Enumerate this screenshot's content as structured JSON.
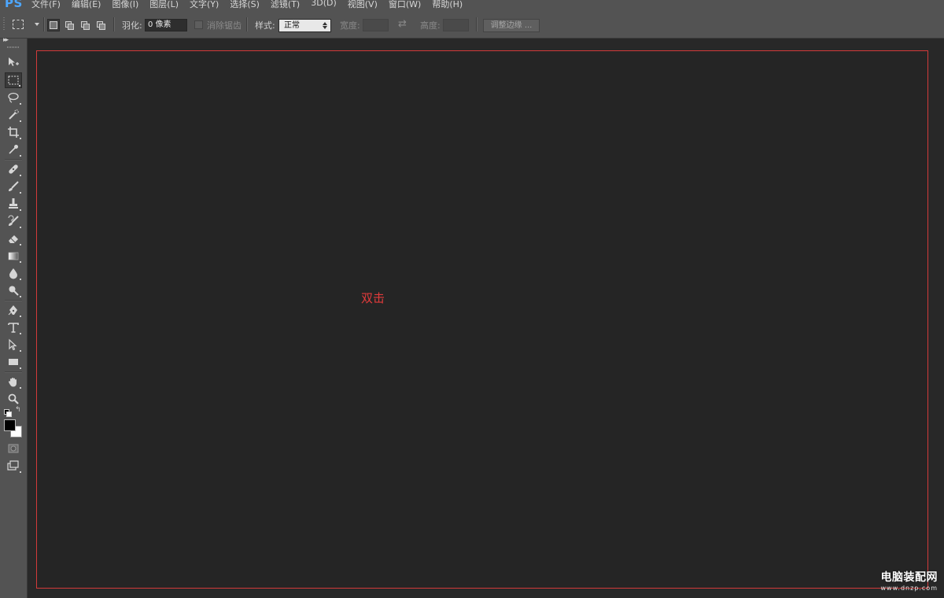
{
  "app": {
    "logo": "PS"
  },
  "menu": [
    "文件(F)",
    "编辑(E)",
    "图像(I)",
    "图层(L)",
    "文字(Y)",
    "选择(S)",
    "滤镜(T)",
    "3D(D)",
    "视图(V)",
    "窗口(W)",
    "帮助(H)"
  ],
  "options": {
    "feather_label": "羽化:",
    "feather_value": "0 像素",
    "antialias_label": "消除锯齿",
    "antialias_checked": false,
    "style_label": "样式:",
    "style_value": "正常",
    "width_label": "宽度:",
    "height_label": "高度:",
    "refine_edge_label": "调整边缘 ..."
  },
  "tools": {
    "active": "rectangular-marquee",
    "list": [
      "move",
      "rectangular-marquee",
      "lasso",
      "quick-selection",
      "crop",
      "eyedropper",
      "spot-healing-brush",
      "brush",
      "clone-stamp",
      "history-brush",
      "eraser",
      "gradient",
      "blur",
      "dodge",
      "pen",
      "type",
      "path-selection",
      "rectangle",
      "hand",
      "zoom",
      "quick-mask",
      "screen-mode"
    ],
    "foreground_color": "#000000",
    "background_color": "#ffffff"
  },
  "canvas": {
    "background": "#252525",
    "annotation_text": "双击",
    "annotation_color": "#e23b3b"
  },
  "watermark": {
    "title": "电脑装配网",
    "url": "www.dnzp.com"
  }
}
